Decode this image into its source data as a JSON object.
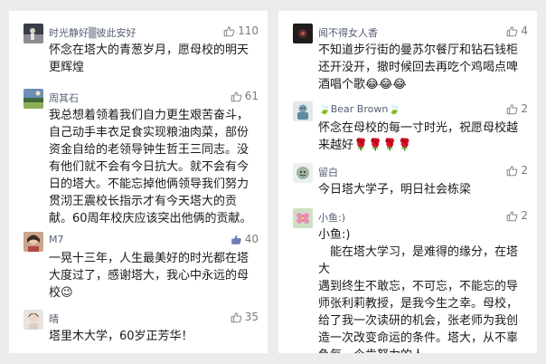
{
  "left_comments": [
    {
      "name": "时光静好▒彼此安好",
      "likes": "110",
      "text": "怀念在塔大的青葱岁月，愿母校的明天\n更辉煌"
    },
    {
      "name": "周其石",
      "likes": "61",
      "text": "我总想着领着我们自力更生艰苦奋斗，\n自己动手丰衣足食实现粮油肉菜，部份\n资金自给的老领导钟生哲王三同志。没\n有他们就不会有今日抗大。就不会有今\n日的塔大。不能忘掉他俩领导我们努力\n贯沏王震校长指示才有今天塔大的贡\n献。60周年校庆应该突出他俩的贡献。"
    },
    {
      "name": "M7",
      "likes": "40",
      "text": "一晃十三年，人生最美好的时光都在塔\n大度过了，感谢塔大，我心中永远的母\n校😉"
    },
    {
      "name": "晴",
      "likes": "35",
      "text": "塔里木大学，60岁正芳华！"
    }
  ],
  "right_comments": [
    {
      "name": "闻不得女人香",
      "likes": "4",
      "text": "不知道步行街的曼苏尔餐厅和钻石钱柜\n还开没开，撤时候回去再吃个鸡喝点啤\n酒唱个歌😂😂😂"
    },
    {
      "name": "🍃Bear Brown🍃",
      "likes": "2",
      "text": "怀念在母校的每一寸时光，祝愿母校越\n来越好🌹🌹🌹🌹"
    },
    {
      "name": "留白",
      "likes": "2",
      "text": "今日塔大学子，明日社会栋梁"
    },
    {
      "name": "小鱼:)",
      "likes": "2",
      "text": "小鱼:)\n　能在塔大学习，是难得的缘分，在塔大\n遇到终生不敢忘，不可忘，不能忘的导\n师张利莉教授，是我今生之幸。母校，\n给了我一次读研的机会，张老师为我创\n造一次改变命运的条件。塔大，从不辜\n负每一个肯努力的人。"
    }
  ],
  "colors": {
    "name": "#555f75",
    "text": "#1a1a1a",
    "likes": "#7a7a7a",
    "background": "#ececec",
    "panel": "#ffffff"
  },
  "icons": {
    "like": "thumbs-up-outline-icon",
    "like_active": "thumbs-up-filled-icon"
  }
}
